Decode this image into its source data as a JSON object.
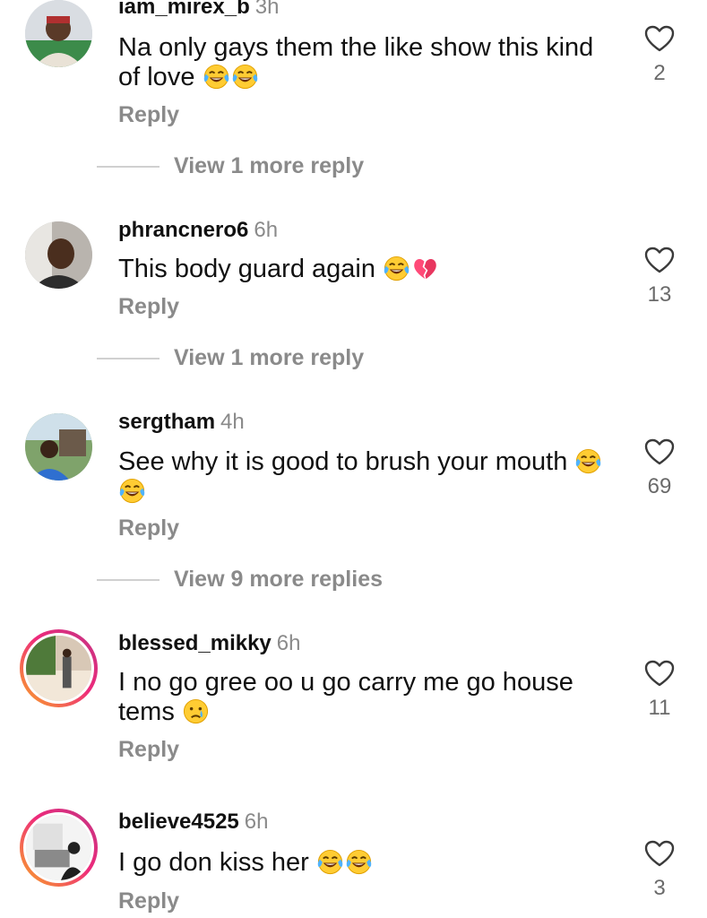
{
  "comments": [
    {
      "username": "iam_mirex_b",
      "time": "3h",
      "text": "Na only gays them the like show this kind of love",
      "emojis": [
        "laughing-tears",
        "laughing-tears"
      ],
      "reply_label": "Reply",
      "likes": "2",
      "view_more": "View 1 more reply",
      "story_ring": false
    },
    {
      "username": "phrancnero6",
      "time": "6h",
      "text": "This body guard again",
      "emojis": [
        "laughing-tears",
        "broken-heart"
      ],
      "reply_label": "Reply",
      "likes": "13",
      "view_more": "View 1 more reply",
      "story_ring": false
    },
    {
      "username": "sergtham",
      "time": "4h",
      "text": "See why it is good to brush your mouth",
      "emojis": [
        "laughing-tears",
        "laughing-tears"
      ],
      "reply_label": "Reply",
      "likes": "69",
      "view_more": "View 9 more replies",
      "story_ring": false
    },
    {
      "username": "blessed_mikky",
      "time": "6h",
      "text": "I no go gree oo u go carry me go house tems",
      "emojis": [
        "crying-face"
      ],
      "reply_label": "Reply",
      "likes": "11",
      "view_more": "",
      "story_ring": true
    },
    {
      "username": "believe4525",
      "time": "6h",
      "text": "I go don kiss her",
      "emojis": [
        "laughing-tears",
        "laughing-tears"
      ],
      "reply_label": "Reply",
      "likes": "3",
      "view_more": "",
      "story_ring": true
    }
  ],
  "colors": {
    "text": "#111111",
    "muted": "#8a8a8a",
    "ring_start": "#f9a825",
    "ring_end": "#c13584"
  }
}
